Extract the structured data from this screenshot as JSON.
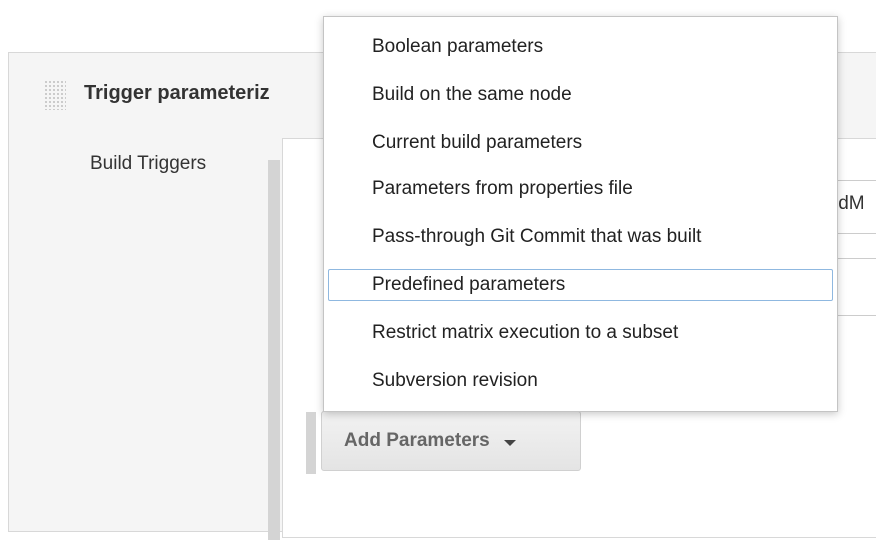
{
  "section": {
    "title": "Trigger parameterized build on other projects",
    "title_visible": "Trigger parameteriz"
  },
  "form": {
    "build_triggers_label": "Build Triggers",
    "field_1_value_partial": "ldM"
  },
  "add_parameters": {
    "label": "Add Parameters"
  },
  "menu": {
    "items": [
      {
        "label": "Boolean parameters"
      },
      {
        "label": "Build on the same node"
      },
      {
        "label": "Current build parameters"
      },
      {
        "label": "Parameters from properties file"
      },
      {
        "label": "Pass-through Git Commit that was built"
      },
      {
        "label": "Predefined parameters"
      },
      {
        "label": "Restrict matrix execution to a subset"
      },
      {
        "label": "Subversion revision"
      }
    ],
    "selected_index": 5
  },
  "icons": {
    "drag_handle": "drag-handle-icon",
    "dropdown_caret": "caret-down-icon"
  },
  "colors": {
    "selection_border": "#8fb8e0",
    "panel_background": "#f5f5f5"
  }
}
